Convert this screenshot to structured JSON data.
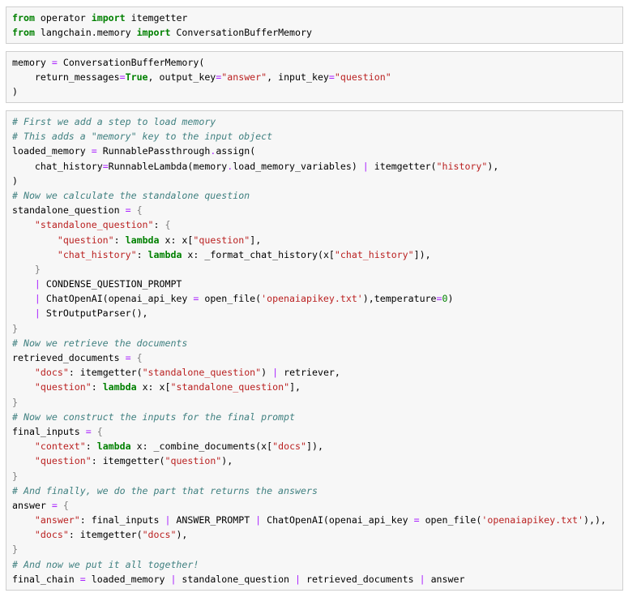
{
  "cells": [
    {
      "lines": [
        [
          [
            "kw",
            "from"
          ],
          [
            "tx",
            " operator "
          ],
          [
            "kw",
            "import"
          ],
          [
            "tx",
            " itemgetter"
          ]
        ],
        [
          [
            "kw",
            "from"
          ],
          [
            "tx",
            " langchain.memory "
          ],
          [
            "kw",
            "import"
          ],
          [
            "tx",
            " ConversationBufferMemory"
          ]
        ]
      ]
    },
    {
      "lines": [
        [
          [
            "tx",
            "memory "
          ],
          [
            "op",
            "="
          ],
          [
            "tx",
            " ConversationBufferMemory("
          ]
        ],
        [
          [
            "tx",
            "    return_messages"
          ],
          [
            "op",
            "="
          ],
          [
            "kw",
            "True"
          ],
          [
            "tx",
            ", output_key"
          ],
          [
            "op",
            "="
          ],
          [
            "st",
            "\"answer\""
          ],
          [
            "tx",
            ", input_key"
          ],
          [
            "op",
            "="
          ],
          [
            "st",
            "\"question\""
          ]
        ],
        [
          [
            "tx",
            ")"
          ]
        ]
      ]
    },
    {
      "lines": [
        [
          [
            "cm",
            "# First we add a step to load memory"
          ]
        ],
        [
          [
            "cm",
            "# This adds a \"memory\" key to the input object"
          ]
        ],
        [
          [
            "tx",
            "loaded_memory "
          ],
          [
            "op",
            "="
          ],
          [
            "tx",
            " RunnablePassthrough"
          ],
          [
            "op",
            "."
          ],
          [
            "tx",
            "assign("
          ]
        ],
        [
          [
            "tx",
            "    chat_history"
          ],
          [
            "op",
            "="
          ],
          [
            "tx",
            "RunnableLambda(memory"
          ],
          [
            "op",
            "."
          ],
          [
            "tx",
            "load_memory_variables) "
          ],
          [
            "op",
            "|"
          ],
          [
            "tx",
            " itemgetter("
          ],
          [
            "st",
            "\"history\""
          ],
          [
            "tx",
            "),"
          ]
        ],
        [
          [
            "tx",
            ")"
          ]
        ],
        [
          [
            "cm",
            "# Now we calculate the standalone question"
          ]
        ],
        [
          [
            "tx",
            "standalone_question "
          ],
          [
            "op",
            "="
          ],
          [
            "tx",
            " "
          ],
          [
            "br",
            "{"
          ]
        ],
        [
          [
            "tx",
            "    "
          ],
          [
            "st",
            "\"standalone_question\""
          ],
          [
            "tx",
            ": "
          ],
          [
            "br",
            "{"
          ]
        ],
        [
          [
            "tx",
            "        "
          ],
          [
            "st",
            "\"question\""
          ],
          [
            "tx",
            ": "
          ],
          [
            "kw",
            "lambda"
          ],
          [
            "tx",
            " x: x["
          ],
          [
            "st",
            "\"question\""
          ],
          [
            "tx",
            "],"
          ]
        ],
        [
          [
            "tx",
            "        "
          ],
          [
            "st",
            "\"chat_history\""
          ],
          [
            "tx",
            ": "
          ],
          [
            "kw",
            "lambda"
          ],
          [
            "tx",
            " x: _format_chat_history(x["
          ],
          [
            "st",
            "\"chat_history\""
          ],
          [
            "tx",
            "]),"
          ]
        ],
        [
          [
            "tx",
            "    "
          ],
          [
            "br",
            "}"
          ]
        ],
        [
          [
            "tx",
            "    "
          ],
          [
            "op",
            "|"
          ],
          [
            "tx",
            " CONDENSE_QUESTION_PROMPT"
          ]
        ],
        [
          [
            "tx",
            "    "
          ],
          [
            "op",
            "|"
          ],
          [
            "tx",
            " ChatOpenAI(openai_api_key "
          ],
          [
            "op",
            "="
          ],
          [
            "tx",
            " open_file("
          ],
          [
            "st",
            "'openaiapikey.txt'"
          ],
          [
            "tx",
            "),temperature"
          ],
          [
            "op",
            "="
          ],
          [
            "nu",
            "0"
          ],
          [
            "tx",
            ")"
          ]
        ],
        [
          [
            "tx",
            "    "
          ],
          [
            "op",
            "|"
          ],
          [
            "tx",
            " StrOutputParser(),"
          ]
        ],
        [
          [
            "br",
            "}"
          ]
        ],
        [
          [
            "cm",
            "# Now we retrieve the documents"
          ]
        ],
        [
          [
            "tx",
            "retrieved_documents "
          ],
          [
            "op",
            "="
          ],
          [
            "tx",
            " "
          ],
          [
            "br",
            "{"
          ]
        ],
        [
          [
            "tx",
            "    "
          ],
          [
            "st",
            "\"docs\""
          ],
          [
            "tx",
            ": itemgetter("
          ],
          [
            "st",
            "\"standalone_question\""
          ],
          [
            "tx",
            ") "
          ],
          [
            "op",
            "|"
          ],
          [
            "tx",
            " retriever,"
          ]
        ],
        [
          [
            "tx",
            "    "
          ],
          [
            "st",
            "\"question\""
          ],
          [
            "tx",
            ": "
          ],
          [
            "kw",
            "lambda"
          ],
          [
            "tx",
            " x: x["
          ],
          [
            "st",
            "\"standalone_question\""
          ],
          [
            "tx",
            "],"
          ]
        ],
        [
          [
            "br",
            "}"
          ]
        ],
        [
          [
            "cm",
            "# Now we construct the inputs for the final prompt"
          ]
        ],
        [
          [
            "tx",
            "final_inputs "
          ],
          [
            "op",
            "="
          ],
          [
            "tx",
            " "
          ],
          [
            "br",
            "{"
          ]
        ],
        [
          [
            "tx",
            "    "
          ],
          [
            "st",
            "\"context\""
          ],
          [
            "tx",
            ": "
          ],
          [
            "kw",
            "lambda"
          ],
          [
            "tx",
            " x: _combine_documents(x["
          ],
          [
            "st",
            "\"docs\""
          ],
          [
            "tx",
            "]),"
          ]
        ],
        [
          [
            "tx",
            "    "
          ],
          [
            "st",
            "\"question\""
          ],
          [
            "tx",
            ": itemgetter("
          ],
          [
            "st",
            "\"question\""
          ],
          [
            "tx",
            "),"
          ]
        ],
        [
          [
            "br",
            "}"
          ]
        ],
        [
          [
            "cm",
            "# And finally, we do the part that returns the answers"
          ]
        ],
        [
          [
            "tx",
            "answer "
          ],
          [
            "op",
            "="
          ],
          [
            "tx",
            " "
          ],
          [
            "br",
            "{"
          ]
        ],
        [
          [
            "tx",
            "    "
          ],
          [
            "st",
            "\"answer\""
          ],
          [
            "tx",
            ": final_inputs "
          ],
          [
            "op",
            "|"
          ],
          [
            "tx",
            " ANSWER_PROMPT "
          ],
          [
            "op",
            "|"
          ],
          [
            "tx",
            " ChatOpenAI(openai_api_key "
          ],
          [
            "op",
            "="
          ],
          [
            "tx",
            " open_file("
          ],
          [
            "st",
            "'openaiapikey.txt'"
          ],
          [
            "tx",
            "),),"
          ]
        ],
        [
          [
            "tx",
            "    "
          ],
          [
            "st",
            "\"docs\""
          ],
          [
            "tx",
            ": itemgetter("
          ],
          [
            "st",
            "\"docs\""
          ],
          [
            "tx",
            "),"
          ]
        ],
        [
          [
            "br",
            "}"
          ]
        ],
        [
          [
            "cm",
            "# And now we put it all together!"
          ]
        ],
        [
          [
            "tx",
            "final_chain "
          ],
          [
            "op",
            "="
          ],
          [
            "tx",
            " loaded_memory "
          ],
          [
            "op",
            "|"
          ],
          [
            "tx",
            " standalone_question "
          ],
          [
            "op",
            "|"
          ],
          [
            "tx",
            " retrieved_documents "
          ],
          [
            "op",
            "|"
          ],
          [
            "tx",
            " answer"
          ]
        ]
      ]
    }
  ],
  "colors": {
    "keyword": "#008000",
    "comment": "#408080",
    "string": "#ba2121",
    "operator": "#aa22ff",
    "number": "#008000",
    "brace": "#808080",
    "text": "#000000",
    "cell_background": "#f7f7f7",
    "cell_border": "#cfcfcf"
  }
}
